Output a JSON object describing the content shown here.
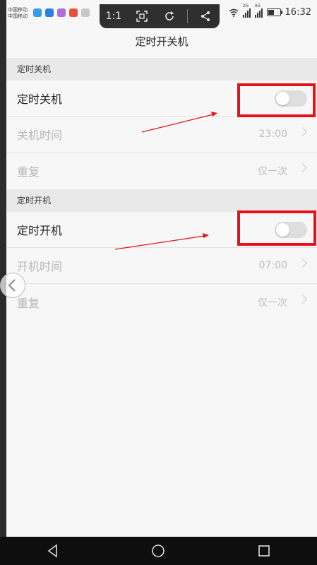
{
  "status_bar": {
    "carrier_1": "中国移动",
    "carrier_2": "中国移动",
    "network_1": "2G",
    "network_2": "4G",
    "time": "16:32"
  },
  "screenshot_toolbar": {
    "ratio_label": "1:1",
    "icons": [
      "fit-screen-icon",
      "rotate-icon",
      "share-icon"
    ]
  },
  "page": {
    "title": "定时开关机"
  },
  "sections": [
    {
      "header": "定时关机",
      "toggle_label": "定时关机",
      "toggle_on": false,
      "time_label": "关机时间",
      "time_value": "23:00",
      "repeat_label": "重复",
      "repeat_value": "仅一次"
    },
    {
      "header": "定时开机",
      "toggle_label": "定时开机",
      "toggle_on": false,
      "time_label": "开机时间",
      "time_value": "07:00",
      "repeat_label": "重复",
      "repeat_value": "仅一次"
    }
  ],
  "colors": {
    "annotation": "#e8111a",
    "background": "#f7f7f7",
    "section_bg": "#e9e9e9",
    "toggle_off": "#dedede"
  }
}
